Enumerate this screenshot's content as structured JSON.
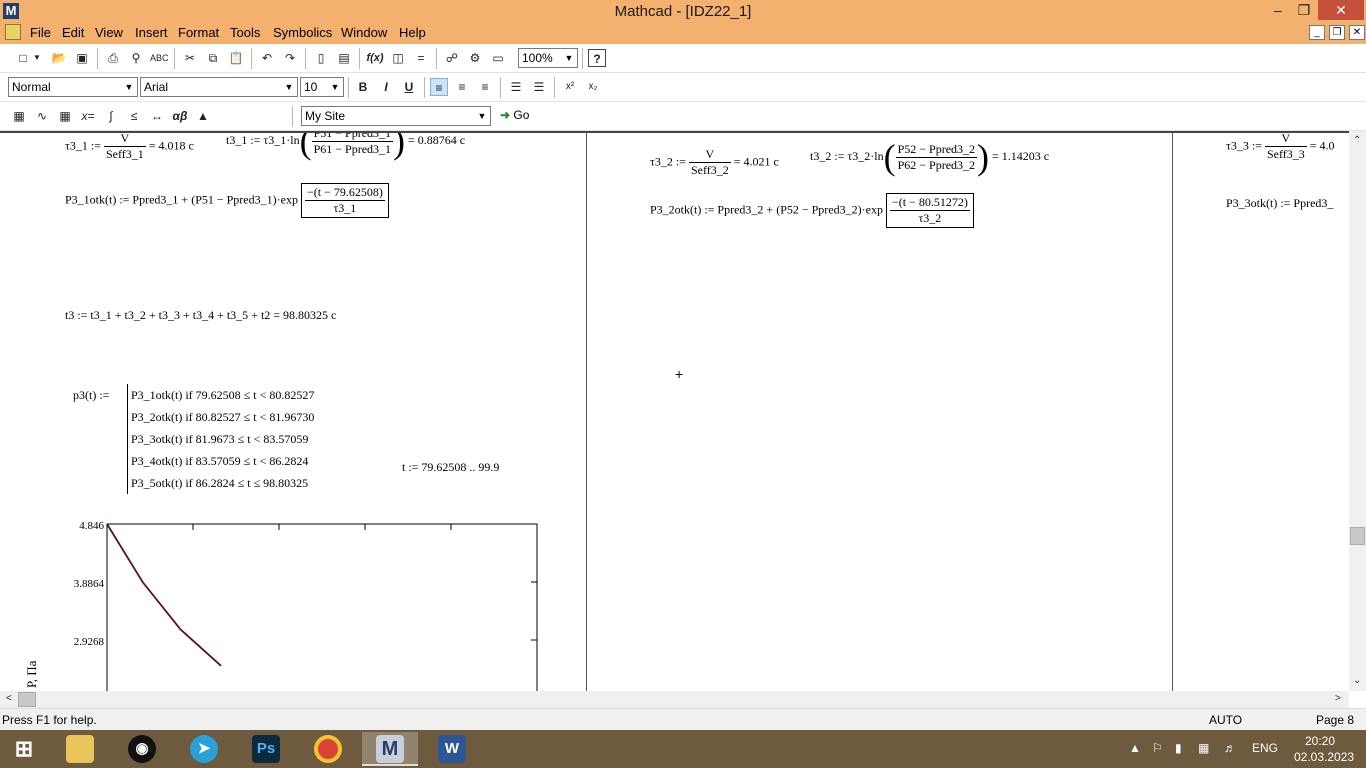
{
  "window": {
    "title": "Mathcad - [IDZ22_1]"
  },
  "menu": [
    "File",
    "Edit",
    "View",
    "Insert",
    "Format",
    "Tools",
    "Symbolics",
    "Window",
    "Help"
  ],
  "toolbar": {
    "zoom": "100%"
  },
  "format_bar": {
    "style": "Normal",
    "font": "Arial",
    "size": "10"
  },
  "math_bar": {
    "resource": "My Site",
    "go_label": "Go"
  },
  "sheet": {
    "col1": {
      "tau3_1_lhs": "τ3_1 :=",
      "tau3_1_num": "V",
      "tau3_1_den": "Seff3_1",
      "tau3_1_res": "= 4.018  c",
      "t3_1_lhs": "t3_1 := τ3_1·ln",
      "t3_1_num": "P51 − Ppred3_1",
      "t3_1_den": "P61 − Ppred3_1",
      "t3_1_res": "= 0.88764  c",
      "p3_1_lhs": "P3_1otk(t) := Ppred3_1 + (P51 − Ppred3_1)·exp",
      "p3_1_num": "−(t − 79.62508)",
      "p3_1_den": "τ3_1",
      "t3_sum": "t3 := t3_1 + t3_2 + t3_3 + t3_4 + t3_5 + t2 = 98.80325  c",
      "p3_lhs": "p3(t) :=",
      "piece": [
        "P3_1otk(t)  if  79.62508 ≤ t < 80.82527",
        "P3_2otk(t)  if  80.82527 ≤ t < 81.96730",
        "P3_3otk(t)  if  81.9673 ≤ t < 83.57059",
        "P3_4otk(t)  if  83.57059 ≤ t < 86.2824",
        "P3_5otk(t)  if  86.2824 ≤ t ≤ 98.80325"
      ],
      "t_range": "t := 79.62508 .. 99.9"
    },
    "col2": {
      "tau3_2_lhs": "τ3_2 :=",
      "tau3_2_num": "V",
      "tau3_2_den": "Seff3_2",
      "tau3_2_res": "= 4.021  c",
      "t3_2_lhs": "t3_2 := τ3_2·ln",
      "t3_2_num": "P52 − Ppred3_2",
      "t3_2_den": "P62 − Ppred3_2",
      "t3_2_res": "= 1.14203  c",
      "p3_2_lhs": "P3_2otk(t) := Ppred3_2 + (P52 − Ppred3_2)·exp",
      "p3_2_num": "−(t − 80.51272)",
      "p3_2_den": "τ3_2"
    },
    "col3": {
      "tau3_3_lhs": "τ3_3 :=",
      "tau3_3_num": "V",
      "tau3_3_den": "Seff3_3",
      "tau3_3_res": "= 4.0",
      "p3_3_lhs": "P3_3otk(t) := Ppred3_"
    }
  },
  "chart_data": {
    "type": "line",
    "ylabel": "P, Па",
    "y_ticks": [
      "4.846",
      "3.8864",
      "2.9268"
    ],
    "x": [
      79.62508,
      80.0,
      80.4,
      80.82527
    ],
    "y": [
      4.846,
      3.8864,
      3.1,
      2.5
    ],
    "series": [
      {
        "color": "#5a1010"
      }
    ]
  },
  "status": {
    "help": "Press F1 for help.",
    "mode": "AUTO",
    "page": "Page 8"
  },
  "taskbar": {
    "lang": "ENG",
    "time": "20:20",
    "date": "02.03.2023"
  }
}
